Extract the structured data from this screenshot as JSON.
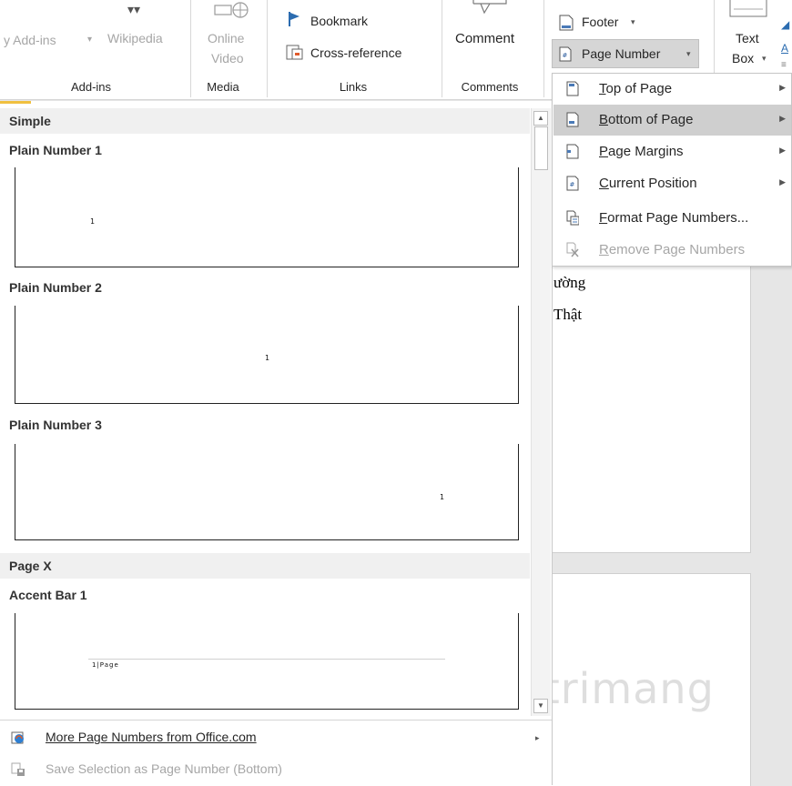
{
  "ribbon": {
    "addins_button": "y Add-ins",
    "wikipedia": "Wikipedia",
    "online_video_line1": "Online",
    "online_video_line2": "Video",
    "bookmark": "Bookmark",
    "cross_reference": "Cross-reference",
    "comment": "Comment",
    "footer": "Footer",
    "page_number": "Page Number",
    "text_box_line1": "Text",
    "text_box_line2": "Box",
    "groups": {
      "addins": "Add-ins",
      "media": "Media",
      "links": "Links",
      "comments": "Comments"
    }
  },
  "gallery": {
    "section_simple": "Simple",
    "section_page_x": "Page X",
    "items": [
      {
        "title": "Plain Number 1",
        "preview": "1"
      },
      {
        "title": "Plain Number 2",
        "preview": "1"
      },
      {
        "title": "Plain Number 3",
        "preview": "1"
      },
      {
        "title": "Accent Bar 1",
        "preview": "1|Page"
      }
    ],
    "more_page_numbers": "More Page Numbers from Office.com",
    "save_selection": "Save Selection as Page Number (Bottom)"
  },
  "submenu": {
    "items": [
      {
        "label": "Top of Page",
        "underline": "T",
        "rest": "op of Page",
        "has_arrow": true,
        "active": false,
        "disabled": false
      },
      {
        "label": "Bottom of Page",
        "underline": "B",
        "rest": "ottom of Page",
        "has_arrow": true,
        "active": true,
        "disabled": false
      },
      {
        "label": "Page Margins",
        "underline": "P",
        "rest": "age Margins",
        "has_arrow": true,
        "active": false,
        "disabled": false
      },
      {
        "label": "Current Position",
        "underline": "C",
        "rest": "urrent Position",
        "has_arrow": true,
        "active": false,
        "disabled": false
      },
      {
        "label": "Format Page Numbers...",
        "underline": "F",
        "rest": "ormat Page Numbers...",
        "has_arrow": false,
        "active": false,
        "disabled": false
      },
      {
        "label": "Remove Page Numbers",
        "underline": "R",
        "rest": "emove Page Numbers",
        "has_arrow": false,
        "active": false,
        "disabled": true
      }
    ]
  },
  "document": {
    "line1": "ường",
    "line2": "Thật"
  },
  "watermark": "Quantrimang",
  "colors": {
    "active_item": "#cfcfcf",
    "section_bg": "#f0f0f0",
    "disabled_text": "#a6a6a6"
  }
}
